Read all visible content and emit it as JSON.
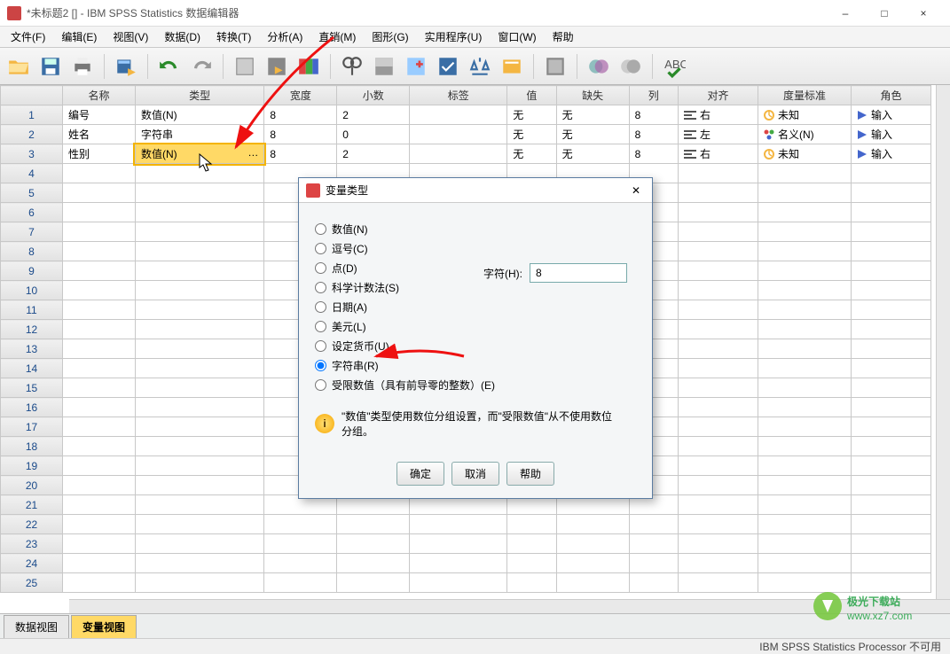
{
  "window": {
    "title": "*未标题2 [] - IBM SPSS Statistics 数据编辑器",
    "minimize": "–",
    "maximize": "□",
    "close": "×"
  },
  "menu": {
    "file": "文件(F)",
    "edit": "编辑(E)",
    "view": "视图(V)",
    "data": "数据(D)",
    "transform": "转换(T)",
    "analyze": "分析(A)",
    "direct": "直销(M)",
    "graphs": "图形(G)",
    "utilities": "实用程序(U)",
    "window": "窗口(W)",
    "help": "帮助"
  },
  "columns": {
    "name": "名称",
    "type": "类型",
    "width": "宽度",
    "decimals": "小数",
    "label": "标签",
    "values": "值",
    "missing": "缺失",
    "cols": "列",
    "align": "对齐",
    "measure": "度量标准",
    "role": "角色"
  },
  "rows": [
    {
      "n": "1",
      "name": "编号",
      "type": "数值(N)",
      "width": "8",
      "dec": "2",
      "label": "",
      "values": "无",
      "missing": "无",
      "cols": "8",
      "align": "右",
      "measure": "未知",
      "role": "输入"
    },
    {
      "n": "2",
      "name": "姓名",
      "type": "字符串",
      "width": "8",
      "dec": "0",
      "label": "",
      "values": "无",
      "missing": "无",
      "cols": "8",
      "align": "左",
      "measure": "名义(N)",
      "role": "输入"
    },
    {
      "n": "3",
      "name": "性别",
      "type": "数值(N)",
      "width": "8",
      "dec": "2",
      "label": "",
      "values": "无",
      "missing": "无",
      "cols": "8",
      "align": "右",
      "measure": "未知",
      "role": "输入"
    }
  ],
  "empty_rows": [
    "4",
    "5",
    "6",
    "7",
    "8",
    "9",
    "10",
    "11",
    "12",
    "13",
    "14",
    "15",
    "16",
    "17",
    "18",
    "19",
    "20",
    "21",
    "22",
    "23",
    "24",
    "25"
  ],
  "tabs": {
    "data_view": "数据视图",
    "var_view": "变量视图"
  },
  "status": "IBM SPSS Statistics Processor 不可用",
  "dialog": {
    "title": "变量类型",
    "options": {
      "numeric": "数值(N)",
      "comma": "逗号(C)",
      "dot": "点(D)",
      "scientific": "科学计数法(S)",
      "date": "日期(A)",
      "dollar": "美元(L)",
      "custom": "设定货币(U)",
      "string": "字符串(R)",
      "restricted": "受限数值（具有前导零的整数）(E)"
    },
    "chars_label": "字符(H):",
    "chars_value": "8",
    "info": "\"数值\"类型使用数位分组设置，而\"受限数值\"从不使用数位分组。",
    "ok": "确定",
    "cancel": "取消",
    "help": "帮助"
  },
  "watermark": "极光下载站",
  "watermark_url": "www.xz7.com"
}
